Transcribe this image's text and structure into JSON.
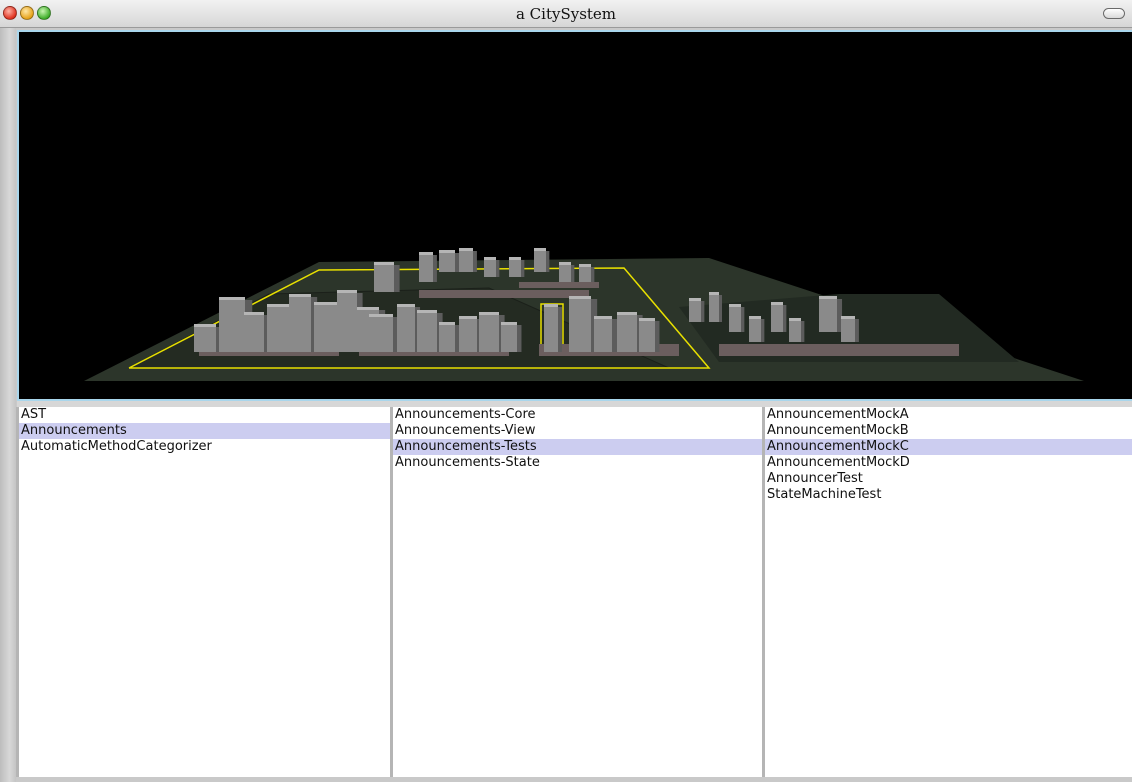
{
  "window": {
    "title": "a CitySystem"
  },
  "lists": {
    "packages": [
      {
        "label": "AST",
        "selected": false
      },
      {
        "label": "Announcements",
        "selected": true
      },
      {
        "label": "AutomaticMethodCategorizer",
        "selected": false
      }
    ],
    "categories": [
      {
        "label": "Announcements-Core",
        "selected": false
      },
      {
        "label": "Announcements-View",
        "selected": false
      },
      {
        "label": "Announcements-Tests",
        "selected": true
      },
      {
        "label": "Announcements-State",
        "selected": false
      }
    ],
    "classes": [
      {
        "label": "AnnouncementMockA",
        "selected": false
      },
      {
        "label": "AnnouncementMockB",
        "selected": false
      },
      {
        "label": "AnnouncementMockC",
        "selected": true
      },
      {
        "label": "AnnouncementMockD",
        "selected": false
      },
      {
        "label": "AnnouncerTest",
        "selected": false
      },
      {
        "label": "StateMachineTest",
        "selected": false
      }
    ]
  },
  "colors": {
    "selection": "#cccdf0",
    "viewport_border": "#a9d6ec",
    "ground": "#2c352a",
    "highlight": "#e8e000",
    "building": "#8a8a8a"
  }
}
